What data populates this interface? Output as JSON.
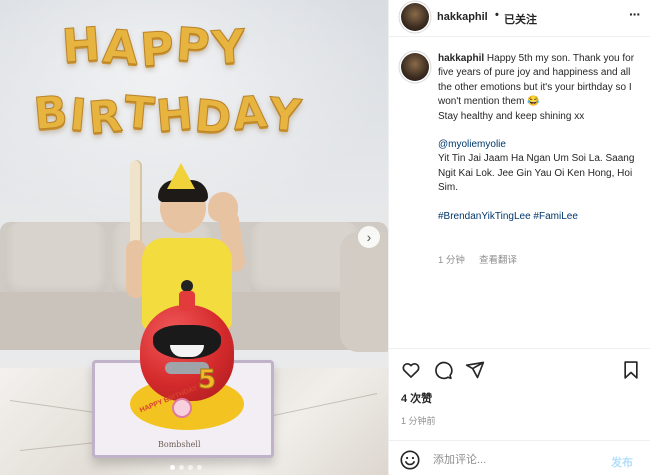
{
  "photo": {
    "balloons_line1": [
      "H",
      "A",
      "P",
      "P",
      "Y"
    ],
    "balloons_line2": [
      "B",
      "I",
      "R",
      "T",
      "H",
      "D",
      "A",
      "Y"
    ],
    "cake_number": "5",
    "cake_board_label": "Bombshell",
    "carousel_next_glyph": "›",
    "dot_count": 4,
    "active_dot": 0
  },
  "header": {
    "username": "hakkaphil",
    "separator": "•",
    "follow_label": "已关注",
    "more_glyph": "···"
  },
  "caption": {
    "username": "hakkaphil",
    "text_1": "Happy 5th my son. Thank you for five years of pure joy and happiness and all the other emotions but it's your birthday so I won't mention them 😂",
    "text_2": "Stay healthy and keep shining xx",
    "mention": "@myoliemyolie",
    "text_3": "Yit Tin Jai Jaam Ha Ngan Um Soi La. Saang Ngit Kai Lok. Jee Gin Yau Oi Ken Hong, Hoi Sim.",
    "hashtags": "#BrendanYikTingLee #FamiLee",
    "time": "1 分钟",
    "translate_label": "查看翻译"
  },
  "actions": {
    "like_icon": "heart-outline",
    "comment_icon": "speech-bubble",
    "share_icon": "paper-plane",
    "save_icon": "bookmark-outline"
  },
  "stats": {
    "likes": "4 次赞",
    "time_ago": "1 分钟前"
  },
  "comment": {
    "placeholder": "添加评论...",
    "post_label": "发布"
  }
}
